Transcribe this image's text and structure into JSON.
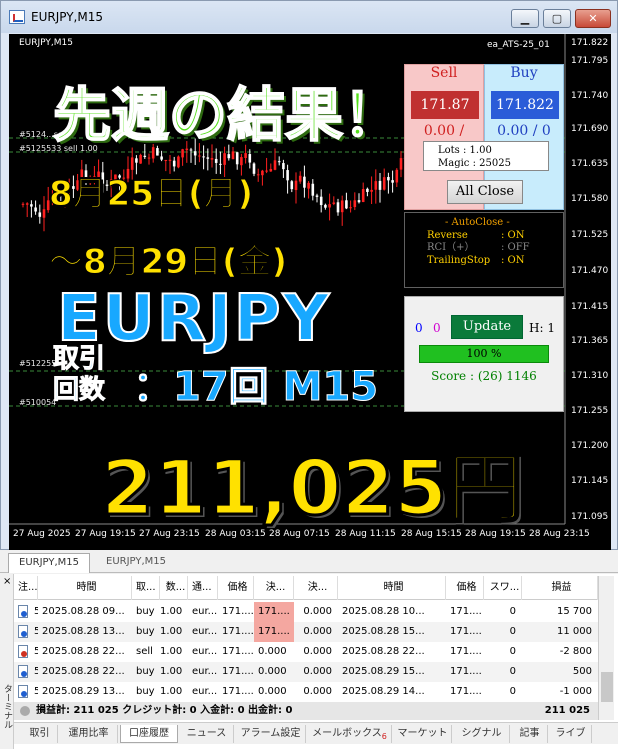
{
  "window": {
    "title": "EURJPY,M15"
  },
  "chart": {
    "symbol_label": "EURJPY,M15",
    "ea_label": "ea_ATS-25_01",
    "trade_labels": [
      "#5124...sell",
      "#5125533 sell 1.00",
      "#512255",
      "#510054"
    ],
    "price_axis": [
      "171.822",
      "171.795",
      "171.740",
      "171.690",
      "171.635",
      "171.580",
      "171.525",
      "171.470",
      "171.415",
      "171.365",
      "171.310",
      "171.255",
      "171.200",
      "171.145",
      "171.095"
    ],
    "time_axis": [
      "27 Aug 2025",
      "27 Aug 19:15",
      "27 Aug 23:15",
      "28 Aug 03:15",
      "28 Aug 07:15",
      "28 Aug 11:15",
      "28 Aug 15:15",
      "28 Aug 19:15",
      "28 Aug 23:15"
    ]
  },
  "overlay": {
    "title": "先週の結果！",
    "date_from": "8月25日(月)",
    "date_to": "～8月29日(金)",
    "pair": "EURJPY",
    "count_label": "取引\n回数",
    "count": "：17回 M15",
    "profit": "211,025円"
  },
  "ea_panel": {
    "sell_title": "Sell",
    "sell_price": "171.87",
    "sell_pl": "0.00 /",
    "buy_title": "Buy",
    "buy_price": "171.822",
    "buy_pl": "0.00 / 0",
    "lots": "Lots   : 1.00",
    "magic": "Magic : 25025",
    "all_close": "All Close",
    "autoclose_header": "- AutoClose -",
    "autoclose": [
      {
        "label": "Reverse",
        "value": ": ON"
      },
      {
        "label": "RCI（+）",
        "value": ": OFF"
      },
      {
        "label": "TrailingStop",
        "value": ": ON"
      }
    ],
    "n_blue": "0",
    "n_pink": "0",
    "update": "Update",
    "h": "H: 1",
    "progress_text": "100 %",
    "progress_value": 1.0,
    "score": "Score : (26) 1146"
  },
  "chart_tabs": [
    "EURJPY,M15",
    "EURJPY,M15"
  ],
  "terminal": {
    "close_icon": "×",
    "vertical_label": "ターミナル",
    "columns": [
      "注...",
      "時間",
      "取...",
      "数...",
      "通...",
      "価格",
      "決...",
      "決...",
      "時間",
      "価格",
      "スワ...",
      "損益"
    ],
    "rows": [
      {
        "type": "buy",
        "cells": [
          "51...",
          "2025.08.28 09...",
          "buy",
          "1.00",
          "eur...",
          "171....",
          "171....",
          "0.000",
          "2025.08.28 10...",
          "171....",
          "0",
          "15 700"
        ],
        "hl": true
      },
      {
        "type": "buy",
        "cells": [
          "51...",
          "2025.08.28 13...",
          "buy",
          "1.00",
          "eur...",
          "171....",
          "171....",
          "0.000",
          "2025.08.28 15...",
          "171....",
          "0",
          "11 000"
        ],
        "hl": true
      },
      {
        "type": "sell",
        "cells": [
          "51...",
          "2025.08.28 22...",
          "sell",
          "1.00",
          "eur...",
          "171....",
          "0.000",
          "0.000",
          "2025.08.28 22...",
          "171....",
          "0",
          "-2 800"
        ],
        "hl": false
      },
      {
        "type": "buy",
        "cells": [
          "51...",
          "2025.08.28 22...",
          "buy",
          "1.00",
          "eur...",
          "171....",
          "0.000",
          "0.000",
          "2025.08.29 15...",
          "171....",
          "0",
          "500"
        ],
        "hl": false
      },
      {
        "type": "buy",
        "cells": [
          "51...",
          "2025.08.29 13...",
          "buy",
          "1.00",
          "eur...",
          "171....",
          "0.000",
          "0.000",
          "2025.08.29 14...",
          "171....",
          "0",
          "-1 000"
        ],
        "hl": false
      }
    ],
    "summary": "損益計: 211 025  クレジット計: 0  入金計: 0  出金計: 0",
    "summary_total": "211 025",
    "tabs": [
      "取引",
      "運用比率",
      "口座履歴",
      "ニュース",
      "アラーム設定",
      "メールボックス",
      "マーケット",
      "シグナル",
      "記事",
      "ライブ"
    ],
    "active_tab": "口座履歴",
    "mail_badge": "6"
  },
  "colors": {
    "bull": "#ff2020",
    "bear": "#ffffff",
    "sell_bg": "#f8c8c8",
    "buy_bg": "#c8ecfc",
    "sell_price_bg": "#c03030",
    "buy_price_bg": "#2a5cd8",
    "green_text": "#54e01a",
    "yellow_text": "#ffe100",
    "blue_text": "#18a8ff"
  }
}
